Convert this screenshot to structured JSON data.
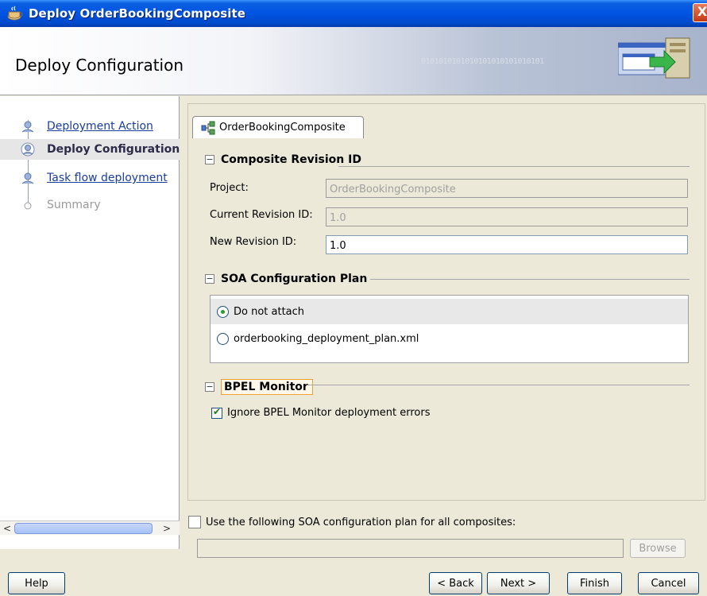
{
  "window": {
    "title": "Deploy OrderBookingComposite",
    "close_glyph": "X"
  },
  "header": {
    "page_title": "Deploy Configuration",
    "decoration_text": "0101010101010101010101010101"
  },
  "nav": {
    "items": [
      {
        "label": "Deployment Action",
        "state": "link"
      },
      {
        "label": "Deploy Configuration",
        "state": "current"
      },
      {
        "label": "Task flow deployment",
        "state": "link"
      },
      {
        "label": "Summary",
        "state": "disabled"
      }
    ]
  },
  "tab": {
    "label": "OrderBookingComposite"
  },
  "sections": {
    "revision": {
      "title": "Composite Revision ID",
      "project_label": "Project:",
      "project_value": "OrderBookingComposite",
      "current_label": "Current Revision ID:",
      "current_value": "1.0",
      "new_label": "New Revision ID:",
      "new_value": "1.0"
    },
    "plan": {
      "title": "SOA Configuration Plan",
      "options": [
        {
          "label": "Do not attach",
          "checked": true
        },
        {
          "label": "orderbooking_deployment_plan.xml",
          "checked": false
        }
      ]
    },
    "bpel": {
      "title": "BPEL Monitor",
      "ignore_label": "Ignore BPEL Monitor deployment errors",
      "ignore_checked": true
    }
  },
  "footer": {
    "use_plan_label": "Use the following SOA configuration plan for all composites:",
    "use_plan_checked": false,
    "path_value": "",
    "browse_label": "Browse"
  },
  "buttons": {
    "help": "Help",
    "back": "< Back",
    "next": "Next >",
    "finish": "Finish",
    "cancel": "Cancel"
  },
  "colors": {
    "titlebar": "#0054e3",
    "link": "#1a3e9e",
    "bpel_highlight": "#f0a030"
  }
}
